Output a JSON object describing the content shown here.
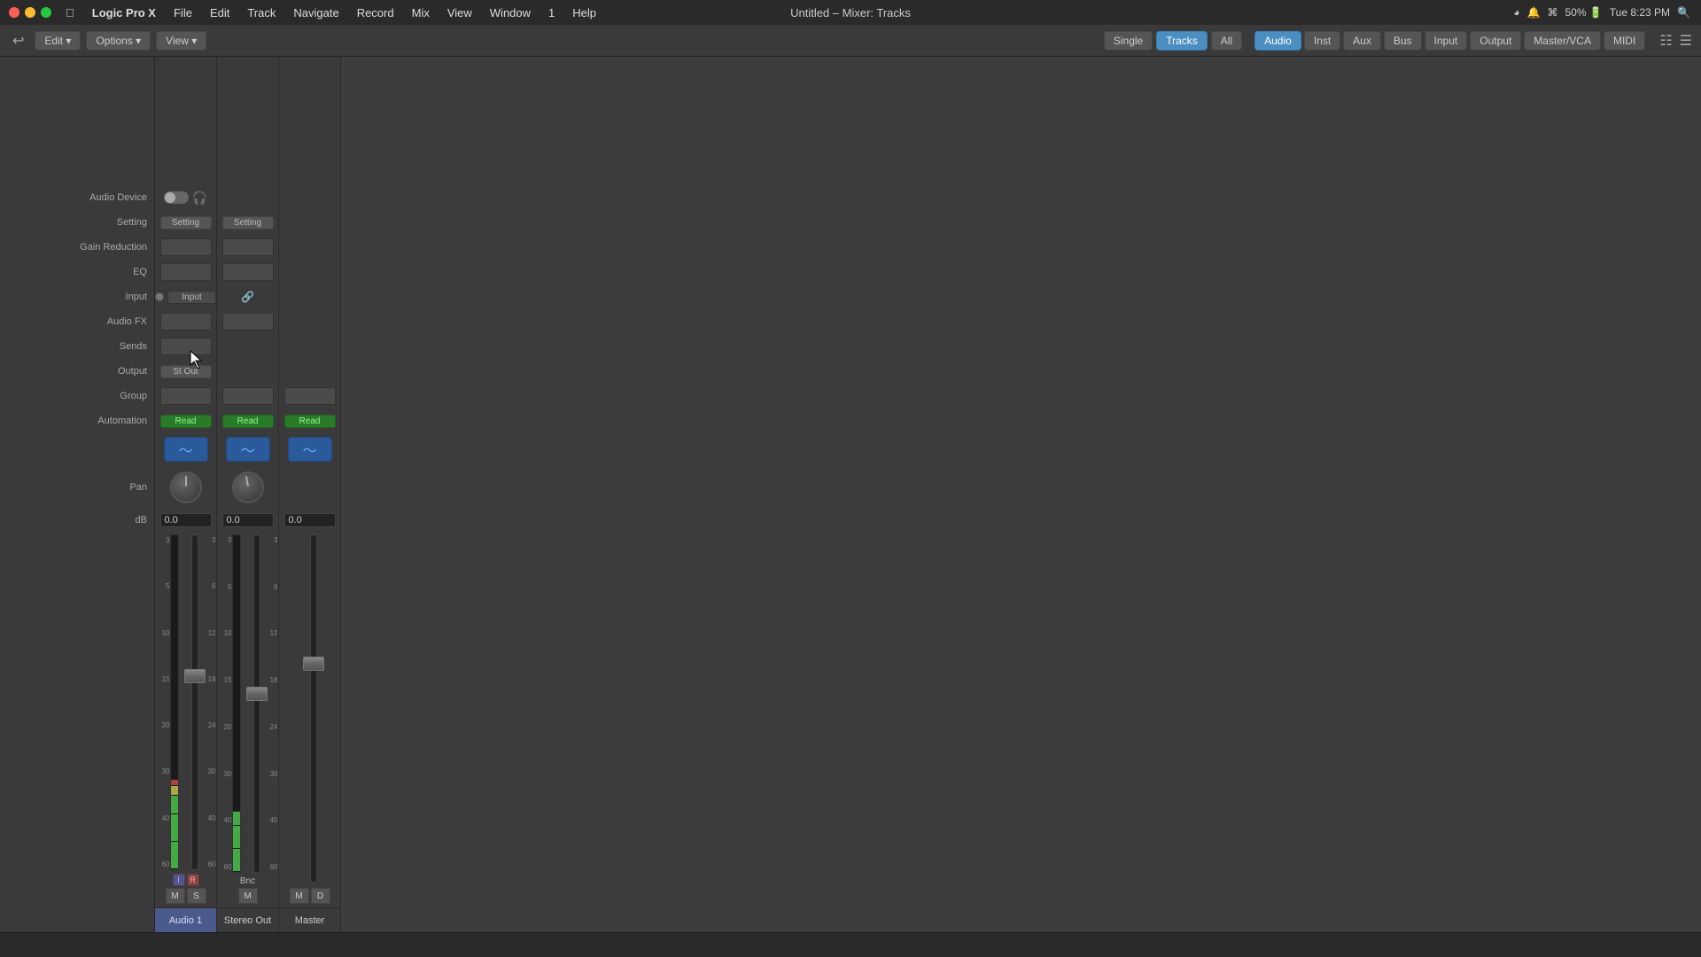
{
  "titlebar": {
    "title": "Untitled – Mixer: Tracks",
    "appName": "Logic Pro X",
    "menus": [
      "Apple",
      "Logic Pro X",
      "File",
      "Edit",
      "Track",
      "Navigate",
      "Record",
      "Mix",
      "View",
      "Window",
      "1",
      "Help"
    ],
    "systemRight": "Tue 8:23 PM",
    "battery": "50%"
  },
  "toolbar": {
    "back_label": "↩",
    "edit_label": "Edit",
    "options_label": "Options",
    "view_label": "View",
    "view_single": "Single",
    "view_tracks": "Tracks",
    "view_all": "All",
    "ch_audio": "Audio",
    "ch_inst": "Inst",
    "ch_aux": "Aux",
    "ch_bus": "Bus",
    "ch_input": "Input",
    "ch_output": "Output",
    "ch_mastervca": "Master/VCA",
    "ch_midi": "MIDI"
  },
  "labels": {
    "audioDevice": "Audio Device",
    "setting": "Setting",
    "gainReduction": "Gain Reduction",
    "eq": "EQ",
    "input": "Input",
    "audioFX": "Audio FX",
    "sends": "Sends",
    "output": "Output",
    "group": "Group",
    "automation": "Automation",
    "pan": "Pan",
    "dB": "dB"
  },
  "channels": [
    {
      "id": "audio1",
      "name": "Audio 1",
      "nameClass": "audio1",
      "setting": "Setting",
      "input": "Input",
      "output": "St Out",
      "automation": "Read",
      "automationClass": "automation-btn",
      "pan": 0,
      "db": "0.0",
      "faderPos": 60,
      "mute": "M",
      "solo": "S",
      "showIR": true,
      "iLabel": "I",
      "rLabel": "R"
    },
    {
      "id": "stereoout",
      "name": "Stereo Out",
      "nameClass": "stereo-out",
      "setting": "Setting",
      "input": null,
      "output": null,
      "automation": "Read",
      "automationClass": "automation-btn",
      "pan": -5,
      "db": "0.0",
      "faderPos": 50,
      "mute": "M",
      "solo": null,
      "showIR": false,
      "bncLabel": "Bnc"
    },
    {
      "id": "master",
      "name": "Master",
      "nameClass": "master",
      "setting": null,
      "input": null,
      "output": null,
      "automation": "Read",
      "automationClass": "automation-btn",
      "pan": 0,
      "db": "0.0",
      "faderPos": 40,
      "mute": "M",
      "solo": null,
      "showD": true,
      "dLabel": "D"
    }
  ]
}
